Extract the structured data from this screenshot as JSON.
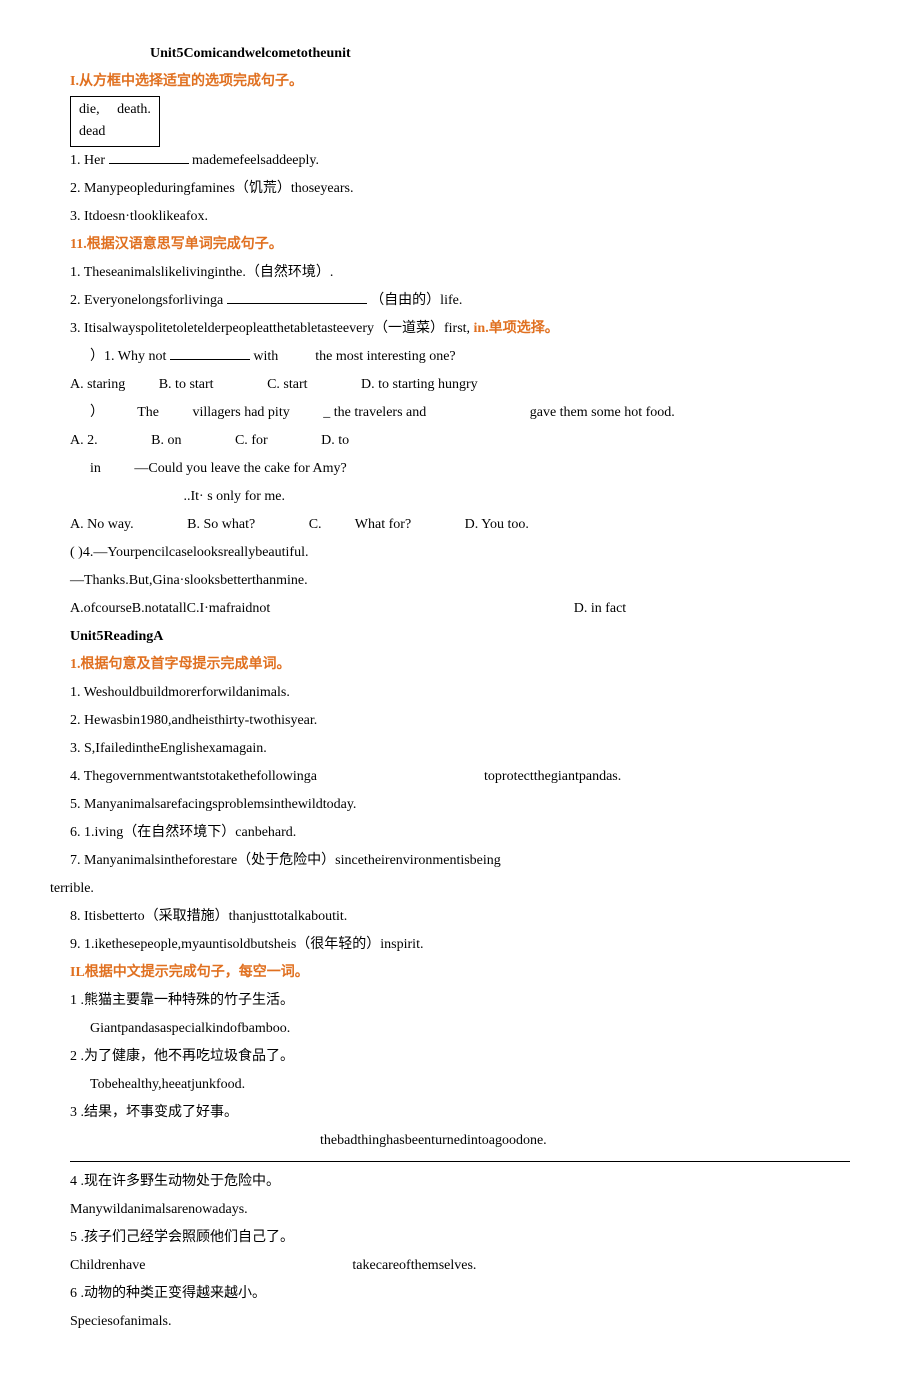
{
  "title": "Unit5Comicandwelcometotheunit",
  "section1": {
    "header": "I.从方框中选择适宜的选项完成句子。",
    "box_line1": "die,     death.",
    "box_line2": "dead",
    "q1": "1. Her",
    "q1b": "mademefeelsaddeeply.",
    "q2": "2. Manypeopleduringfamines（饥荒）thoseyears.",
    "q3": "3. Itdoesn·tlooklikeafox."
  },
  "section2": {
    "header": "11.根据汉语意思写单词完成句子。",
    "q1": "1. Theseanimalslikelivinginthe.（自然环境）.",
    "q2a": "2. Everyonelongsforlivinga",
    "q2b": "（自由的）life.",
    "q3a": "3. Itisalwayspolitetoletelderpeopleatthetabletasteevery（一道菜）first,",
    "q3b": "in.单项选择。"
  },
  "mc": {
    "q1": "）1. Why not",
    "q1b": "with",
    "q1c": "the most",
    "q1d": "interesting one?",
    "q1A": "A.  staring",
    "q1B": "B.  to start",
    "q1C": "C.",
    "q1Cv": "start",
    "q1D": "D. to starting hungry",
    "q2a": "）",
    "q2b": "The",
    "q2c": "villagers had pity",
    "q2d": "_ the travelers and",
    "q2e": "gave them some hot food.",
    "q2A": "A.  2.",
    "q2B": "B. on",
    "q2C": "C.",
    "q2Cv": "for",
    "q2D": "D. to",
    "q3a": "in",
    "q3b": "—Could you leave",
    "q3c": "the cake for Amy?",
    "q3d": "..It· s only",
    "q3e": "for me.",
    "q3A": "A. No way.",
    "q3B": "B. So what?",
    "q3C": "C.",
    "q3Cv": "What for?",
    "q3D": "D. You too.",
    "q4a": "( )4.—Yourpencilcaselooksreallybeautiful.",
    "q4b": "—Thanks.But,Gina·slooksbetterthanmine.",
    "q4c": "A.ofcourseB.notatallC.I·mafraidnot",
    "q4d": "D.  in fact"
  },
  "reading": {
    "title": "Unit5ReadingA",
    "header1": "1.根据句意及首字母提示完成单词。",
    "r1": "1. Weshouldbuildmorerforwildanimals.",
    "r2": "2. Hewasbin1980,andheisthirty-twothisyear.",
    "r3": "3. S,IfailedintheEnglishexamagain.",
    "r4a": "4. Thegovernmentwantstotakethefollowinga",
    "r4b": "toprotectthegiantpandas.",
    "r5": "5. Manyanimalsarefacingsproblemsinthewildtoday.",
    "r6": "6. 1.iving（在自然环境下）canbehard.",
    "r7": "7. Manyanimalsintheforestare（处于危险中）sincetheirenvironmentisbeing",
    "r7b": "terrible.",
    "r8": "8. Itisbetterto（采取措施）thanjusttotalkaboutit.",
    "r9": "9. 1.ikethesepeople,myauntisoldbutsheis（很年轻的）inspirit."
  },
  "cn": {
    "header": "IL根据中文提示完成句子，每空一词。",
    "c1a": "1 .熊猫主要靠一种特殊的竹子生活。",
    "c1b": "Giantpandasaspecialkindofbamboo.",
    "c2a": "2 .为了健康，他不再吃垃圾食品了。",
    "c2b": "Tobehealthy,heeatjunkfood.",
    "c3a": "3 .结果，坏事变成了好事。",
    "c3b": "thebadthinghasbeenturnedintoagoodone.",
    "c4a": "4 .现在许多野生动物处于危险中。",
    "c4b": "Manywildanimalsarenowadays.",
    "c5a": "5 .孩子们己经学会照顾他们自己了。",
    "c5b1": "Childrenhave",
    "c5b2": "takecareofthemselves.",
    "c6a": "6 .动物的种类正变得越来越小。",
    "c6b": "Speciesofanimals."
  }
}
